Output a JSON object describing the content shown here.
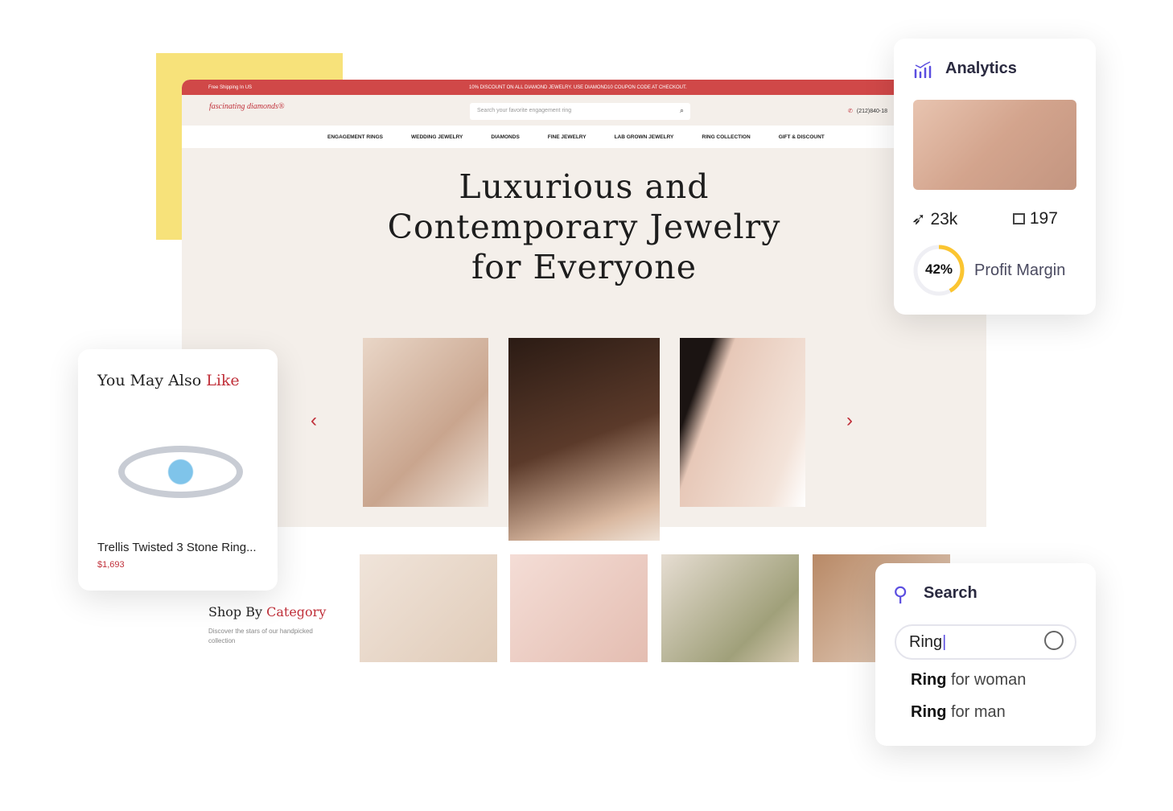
{
  "site": {
    "promo_left": "Free Shipping In US",
    "promo_center": "10% DISCOUNT ON ALL DIAMOND JEWELRY. USE DIAMOND10 COUPON CODE AT CHECKOUT.",
    "logo": "fascinating diamonds®",
    "search_placeholder": "Search your favorite engagement ring",
    "phone": "(212)840-18",
    "nav": [
      "ENGAGEMENT RINGS",
      "WEDDING JEWELRY",
      "DIAMONDS",
      "FINE JEWELRY",
      "LAB GROWN JEWELRY",
      "RING COLLECTION",
      "GIFT & DISCOUNT"
    ],
    "hero_lines": [
      "Luxurious and",
      "Contemporary Jewelry",
      "for Everyone"
    ],
    "shop_title": "Shop By",
    "shop_title_accent": "Category",
    "shop_sub": "Discover the stars of our handpicked collection"
  },
  "recommend": {
    "title": "You May Also",
    "title_accent": "Like",
    "product": "Trellis Twisted 3 Stone Ring...",
    "price": "$1,693"
  },
  "analytics": {
    "title": "Analytics",
    "clicks": "23k",
    "orders": "197",
    "margin_label": "42%",
    "margin_value": 42,
    "margin_text": "Profit Margin"
  },
  "search": {
    "title": "Search",
    "value": "Ring",
    "results": [
      {
        "bold": "Ring",
        "rest": " for woman"
      },
      {
        "bold": "Ring",
        "rest": " for man"
      }
    ]
  },
  "colors": {
    "brand": "#d04848",
    "accent": "#5b4ee0",
    "gauge": "#fbc531"
  }
}
